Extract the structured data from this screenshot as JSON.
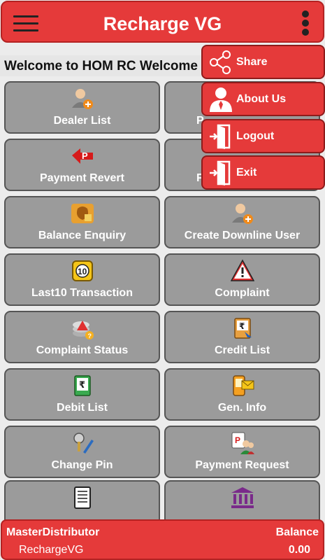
{
  "header": {
    "title": "Recharge VG"
  },
  "ticker": {
    "text": "Welcome to HOM RC Welcome to HOM RC"
  },
  "tiles": [
    {
      "label": "Dealer List",
      "icon": "add-user-icon"
    },
    {
      "label": "P",
      "icon": "hidden-icon"
    },
    {
      "label": "Payment Revert",
      "icon": "payment-revert-icon"
    },
    {
      "label": "F",
      "icon": "hidden-icon"
    },
    {
      "label": "Balance Enquiry",
      "icon": "money-bag-icon"
    },
    {
      "label": "Create Downline User",
      "icon": "add-user-icon"
    },
    {
      "label": "Last10 Transaction",
      "icon": "ten-badge-icon"
    },
    {
      "label": "Complaint",
      "icon": "warning-icon"
    },
    {
      "label": "Complaint Status",
      "icon": "coins-warning-icon"
    },
    {
      "label": "Credit List",
      "icon": "rupee-doc-icon"
    },
    {
      "label": "Debit List",
      "icon": "rupee-green-doc-icon"
    },
    {
      "label": "Gen. Info",
      "icon": "phone-mail-icon"
    },
    {
      "label": "Change Pin",
      "icon": "key-pen-icon"
    },
    {
      "label": "Payment Request",
      "icon": "request-people-icon"
    },
    {
      "label": "",
      "icon": "report-icon"
    },
    {
      "label": "",
      "icon": "bank-icon"
    }
  ],
  "menu": {
    "items": [
      {
        "label": "Share",
        "icon": "share-icon"
      },
      {
        "label": "About Us",
        "icon": "person-icon"
      },
      {
        "label": "Logout",
        "icon": "door-exit-icon"
      },
      {
        "label": "Exit",
        "icon": "door-exit-icon"
      }
    ]
  },
  "footer": {
    "role": "MasterDistributor",
    "username": "RechargeVG",
    "balance_label": "Balance",
    "balance_value": "0.00"
  },
  "colors": {
    "primary": "#e53a3a",
    "tile": "#9b9b9b",
    "dark": "#222222"
  }
}
